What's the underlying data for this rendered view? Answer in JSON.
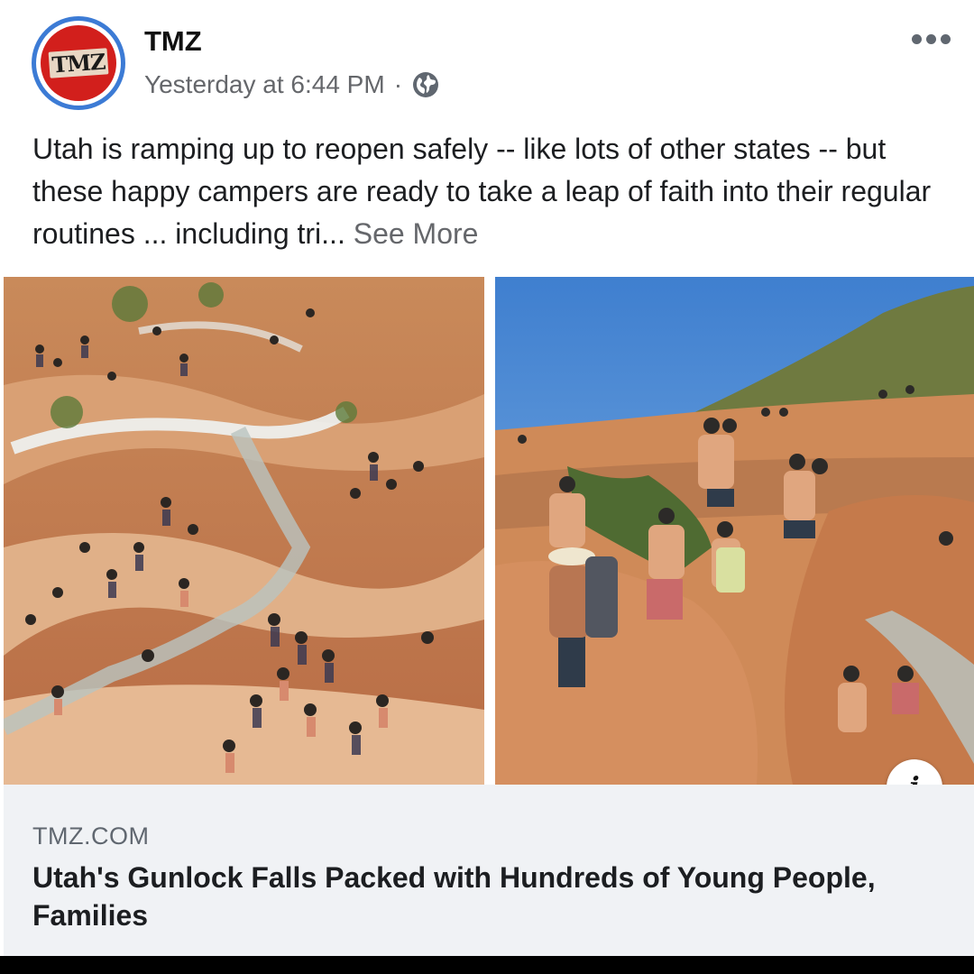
{
  "post": {
    "page_name": "TMZ",
    "avatar_text": "TMZ",
    "timestamp": "Yesterday at 6:44 PM",
    "separator": "·",
    "privacy_icon": "globe-icon",
    "more_icon": "more-options-icon",
    "caption": "Utah is ramping up to reopen safely -- like lots of other states -- but these happy campers are ready to take a leap of faith into their regular routines ... including tri...",
    "see_more": "See More"
  },
  "link_preview": {
    "domain": "TMZ.COM",
    "headline": "Utah's Gunlock Falls Packed with Hundreds of Young People, Families",
    "info_icon": "info-icon",
    "info_glyph": "i"
  },
  "colors": {
    "avatar_ring": "#3c7bd5",
    "avatar_fill": "#d21f1c",
    "secondary_text": "#65676b",
    "link_box_bg": "#f0f2f5"
  }
}
